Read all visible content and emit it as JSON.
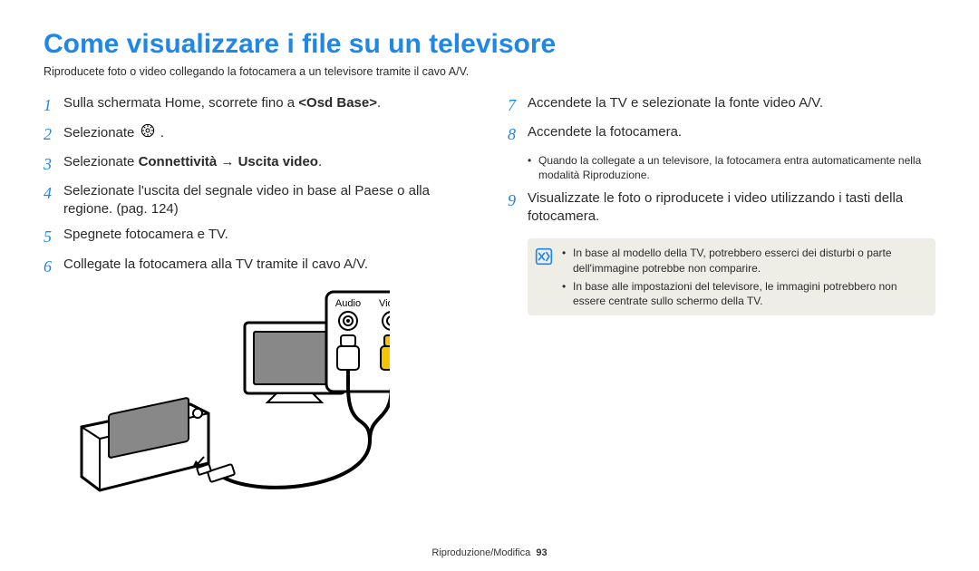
{
  "title": "Come visualizzare i file su un televisore",
  "subtitle": "Riproducete foto o video collegando la fotocamera a un televisore tramite il cavo A/V.",
  "left_steps": {
    "s1": {
      "num": "1",
      "pre": "Sulla schermata Home, scorrete fino a ",
      "em": "<Osd Base>",
      "post": "."
    },
    "s2": {
      "num": "2",
      "text": "Selezionate ",
      "gear_name": "settings-gear-icon",
      "post": " ."
    },
    "s3": {
      "num": "3",
      "pre": "Selezionate ",
      "b1": "Connettività",
      "arrow": " → ",
      "b2": "Uscita video",
      "post": "."
    },
    "s4": {
      "num": "4",
      "text": "Selezionate l'uscita del segnale video in base al Paese o alla regione. (pag. 124)"
    },
    "s5": {
      "num": "5",
      "text": "Spegnete fotocamera e TV."
    },
    "s6": {
      "num": "6",
      "text": "Collegate la fotocamera alla TV tramite il cavo A/V."
    }
  },
  "diagram_labels": {
    "audio": "Audio",
    "video": "Video"
  },
  "right_steps": {
    "s7": {
      "num": "7",
      "text": "Accendete la TV e selezionate la fonte video A/V."
    },
    "s8": {
      "num": "8",
      "text": "Accendete la fotocamera."
    },
    "s8_sub": "Quando la collegate a un televisore, la fotocamera entra automaticamente nella modalità Riproduzione.",
    "s9": {
      "num": "9",
      "text": "Visualizzate le foto o riproducete i video utilizzando i tasti della fotocamera."
    }
  },
  "notes": {
    "n1": "In base al modello della TV, potrebbero esserci dei disturbi o parte dell'immagine potrebbe non comparire.",
    "n2": "In base alle impostazioni del televisore, le immagini potrebbero non essere centrate sullo schermo della TV."
  },
  "footer": {
    "section": "Riproduzione/Modifica",
    "page": "93"
  }
}
